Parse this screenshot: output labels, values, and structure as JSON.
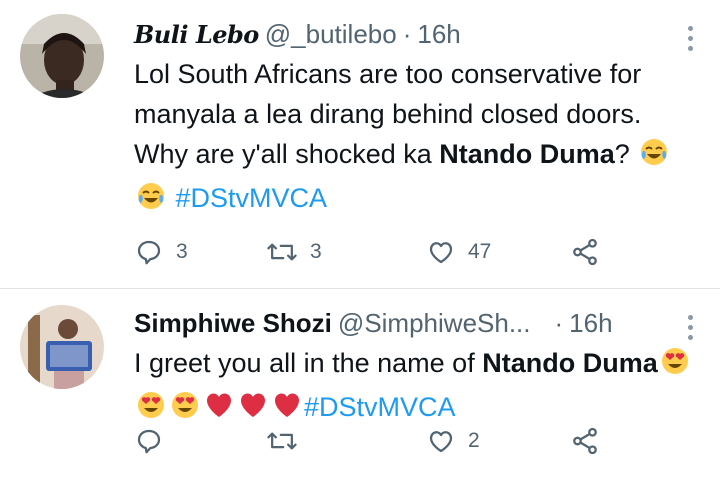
{
  "tweets": [
    {
      "display_name": "Buli Lebo",
      "handle": "@_butilebo",
      "separator": "·",
      "time": "16h",
      "text": {
        "part1": "Lol South Africans are too conservative for manyala a lea dirang behind closed doors. Why are y'all shocked ka ",
        "bold": "Ntando Duma",
        "part2": "?",
        "emoji": [
          "tears-of-joy",
          "tears-of-joy"
        ],
        "hashtag": "#DStvMVCA"
      },
      "actions": {
        "replies": "3",
        "retweets": "3",
        "likes": "47"
      }
    },
    {
      "display_name": "Simphiwe Shozi",
      "handle": "@SimphiweSh...",
      "separator": "·",
      "time": "16h",
      "text": {
        "part1": "I greet you all in the name of ",
        "bold": "Ntando Duma",
        "emoji": [
          "heart-eyes",
          "heart-eyes",
          "heart-eyes",
          "red-heart",
          "red-heart",
          "red-heart"
        ],
        "hashtag": "#DStvMVCA"
      },
      "actions": {
        "replies": "",
        "retweets": "",
        "likes": "2"
      }
    }
  ],
  "colors": {
    "accent": "#1d9bf0",
    "muted": "#536471",
    "text": "#0f1419",
    "divider": "#dfe3e6"
  }
}
